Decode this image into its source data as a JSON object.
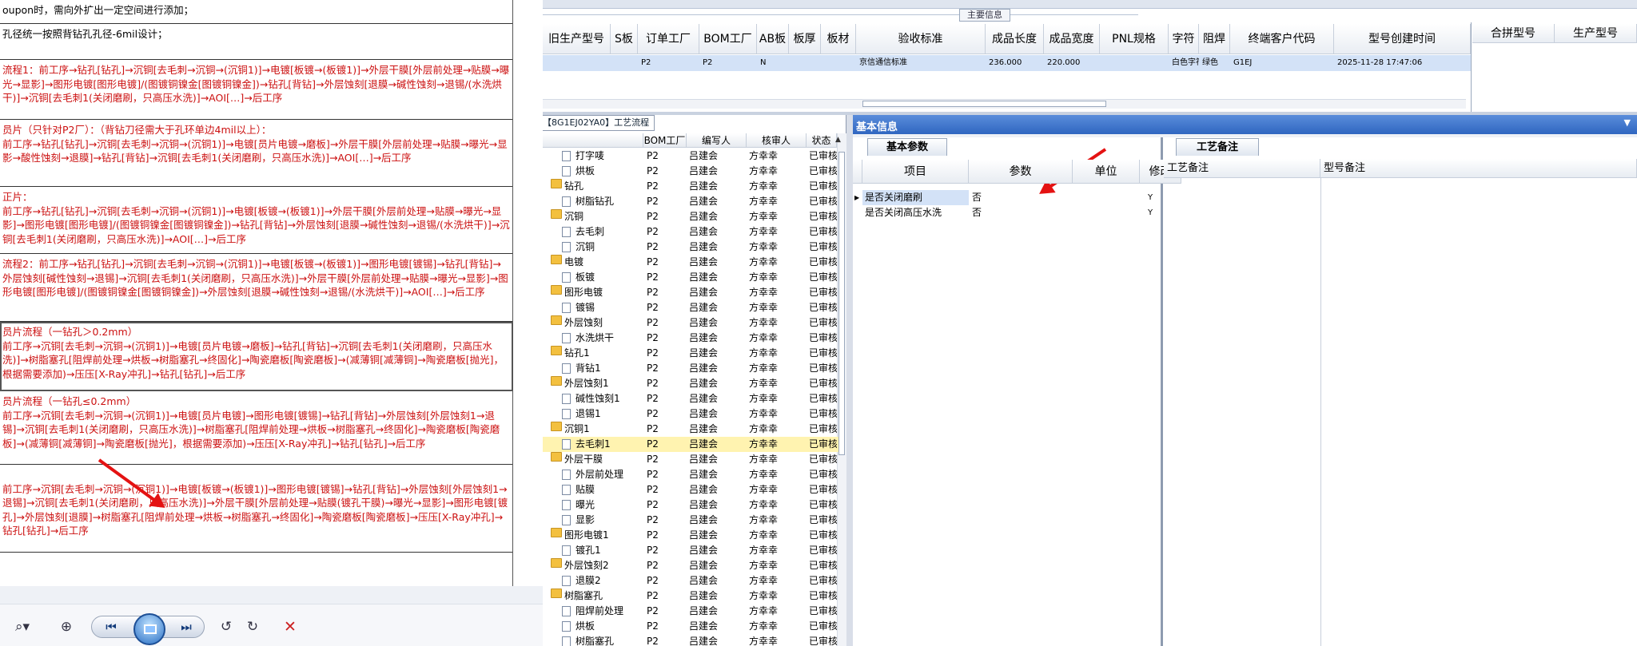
{
  "doc": {
    "rows": [
      {
        "text": "oupon时，需向外扩出一定空间进行添加；",
        "red": false
      },
      {
        "text": "孔径统一按照背钻孔孔径-6mil设计；",
        "red": false
      },
      {
        "text": "流程1：前工序→钻孔[钻孔]→沉铜[去毛刺→沉铜→(沉铜1)]→电镀[板镀→(板镀1)]→外层干膜[外层前处理→贴膜→曝光→显影]→图形电镀[图形电镀]/(图镀铜镍金[图镀铜镍金])→钻孔[背钻]→外层蚀刻[退膜→碱性蚀刻→退锡/(水洗烘干)]→沉铜[去毛刺1(关闭磨刷，只高压水洗)]→AOI[…]→后工序",
        "red": true
      },
      {
        "text": "员片（只针对P2厂）：（背钻刀径需大于孔环单边4mil以上）：\n前工序→钻孔[钻孔]→沉铜[去毛刺→沉铜→(沉铜1)]→电镀[员片电镀→磨板]→外层干膜[外层前处理→贴膜→曝光→显影→酸性蚀刻→退膜]→钻孔[背钻]→沉铜[去毛刺1(关闭磨刷，只高压水洗)]→AOI[…]→后工序",
        "red": true
      },
      {
        "text": "正片：\n前工序→钻孔[钻孔]→沉铜[去毛刺→沉铜→(沉铜1)]→电镀[板镀→(板镀1)]→外层干膜[外层前处理→贴膜→曝光→显影]→图形电镀[图形电镀]/(图镀铜镍金[图镀铜镍金])→钻孔[背钻]→外层蚀刻[退膜→碱性蚀刻→退锡/(水洗烘干)]→沉铜[去毛刺1(关闭磨刷，只高压水洗)]→AOI[…]→后工序",
        "red": true
      },
      {
        "text": "流程2：前工序→钻孔[钻孔]→沉铜[去毛刺→沉铜→(沉铜1)]→电镀[板镀→(板镀1)]→图形电镀[镀锡]→钻孔[背钻]→外层蚀刻[碱性蚀刻→退锡]→沉铜[去毛刺1(关闭磨刷，只高压水洗)]→外层干膜[外层前处理→贴膜→曝光→显影]→图形电镀[图形电镀]/(图镀铜镍金[图镀铜镍金])→外层蚀刻[退膜→碱性蚀刻→退锡/(水洗烘干)]→AOI[…]→后工序",
        "red": true
      },
      {
        "text": "员片流程（一钻孔＞0.2mm）\n前工序→沉铜[去毛刺→沉铜→(沉铜1)]→电镀[员片电镀→磨板]→钻孔[背钻]→沉铜[去毛刺1(关闭磨刷，只高压水洗)]→树脂塞孔[阻焊前处理→烘板→树脂塞孔→终固化]→陶瓷磨板[陶瓷磨板]→(减薄铜[减薄铜]→陶瓷磨板[抛光]，根据需要添加)→压压[X-Ray冲孔]→钻孔[钻孔]→后工序",
        "red": true
      },
      {
        "text": "员片流程（一钻孔≤0.2mm）\n前工序→沉铜[去毛刺→沉铜→(沉铜1)]→电镀[员片电镀]→图形电镀[镀锡]→钻孔[背钻]→外层蚀刻[外层蚀刻1→退锡]→沉铜[去毛刺1(关闭磨刷，只高压水洗)]→树脂塞孔[阻焊前处理→烘板→树脂塞孔→终固化]→陶瓷磨板[陶瓷磨板]→(减薄铜[减薄铜]→陶瓷磨板[抛光]，根据需要添加)→压压[X-Ray冲孔]→钻孔[钻孔]→后工序",
        "red": true
      },
      {
        "text": "\n前工序→沉铜[去毛刺→沉铜→(沉铜1)]→电镀[板镀→(板镀1)]→图形电镀[镀锡]→钻孔[背钻]→外层蚀刻[外层蚀刻1→退锡]→沉铜[去毛刺1(关闭磨刷，只高压水洗)]→外层干膜[外层前处理→贴膜(镀孔干膜)→曝光→显影]→图形电镀[镀孔]→外层蚀刻[退膜]→树脂塞孔[阻焊前处理→烘板→树脂塞孔→终固化]→陶瓷磨板[陶瓷磨板]→压压[X-Ray冲孔]→钻孔[钻孔]→后工序",
        "red": true
      }
    ]
  },
  "main": {
    "group_title": "主要信息",
    "headers": [
      "旧生产型号",
      "S板",
      "订单工厂",
      "BOM工厂",
      "AB板",
      "板厚",
      "板材",
      "验收标准",
      "成品长度",
      "成品宽度",
      "PNL规格",
      "字符",
      "阻焊",
      "终端客户代码",
      "型号创建时间"
    ],
    "row": [
      "",
      "",
      "P2",
      "P2",
      "N",
      "",
      "",
      "京信通信标准",
      "236.000",
      "220.000",
      "",
      "白色字符",
      "绿色",
      "G1EJ",
      "2025-11-28 17:47:06"
    ],
    "right_headers": [
      "合拼型号",
      "生产型号"
    ]
  },
  "tree": {
    "caption": "【8G1EJ02YA0】工艺流程",
    "headers": [
      "",
      "BOM工厂",
      "编写人",
      "核审人",
      "状态"
    ],
    "rows": [
      {
        "name": "打字唛",
        "level": 2,
        "type": "file",
        "bom": "P2",
        "writer": "吕建会",
        "reviewer": "方幸幸",
        "status": "已审核"
      },
      {
        "name": "烘板",
        "level": 2,
        "type": "file",
        "bom": "P2",
        "writer": "吕建会",
        "reviewer": "方幸幸",
        "status": "已审核"
      },
      {
        "name": "钻孔",
        "level": 1,
        "type": "folder",
        "bom": "P2",
        "writer": "吕建会",
        "reviewer": "方幸幸",
        "status": "已审核"
      },
      {
        "name": "树脂钻孔",
        "level": 2,
        "type": "file",
        "bom": "P2",
        "writer": "吕建会",
        "reviewer": "方幸幸",
        "status": "已审核"
      },
      {
        "name": "沉铜",
        "level": 1,
        "type": "folder",
        "bom": "P2",
        "writer": "吕建会",
        "reviewer": "方幸幸",
        "status": "已审核"
      },
      {
        "name": "去毛刺",
        "level": 2,
        "type": "file",
        "bom": "P2",
        "writer": "吕建会",
        "reviewer": "方幸幸",
        "status": "已审核"
      },
      {
        "name": "沉铜",
        "level": 2,
        "type": "file",
        "bom": "P2",
        "writer": "吕建会",
        "reviewer": "方幸幸",
        "status": "已审核"
      },
      {
        "name": "电镀",
        "level": 1,
        "type": "folder",
        "bom": "P2",
        "writer": "吕建会",
        "reviewer": "方幸幸",
        "status": "已审核"
      },
      {
        "name": "板镀",
        "level": 2,
        "type": "file",
        "bom": "P2",
        "writer": "吕建会",
        "reviewer": "方幸幸",
        "status": "已审核"
      },
      {
        "name": "图形电镀",
        "level": 1,
        "type": "folder",
        "bom": "P2",
        "writer": "吕建会",
        "reviewer": "方幸幸",
        "status": "已审核"
      },
      {
        "name": "镀锡",
        "level": 2,
        "type": "file",
        "bom": "P2",
        "writer": "吕建会",
        "reviewer": "方幸幸",
        "status": "已审核"
      },
      {
        "name": "外层蚀刻",
        "level": 1,
        "type": "folder",
        "bom": "P2",
        "writer": "吕建会",
        "reviewer": "方幸幸",
        "status": "已审核"
      },
      {
        "name": "水洗烘干",
        "level": 2,
        "type": "file",
        "bom": "P2",
        "writer": "吕建会",
        "reviewer": "方幸幸",
        "status": "已审核"
      },
      {
        "name": "钻孔1",
        "level": 1,
        "type": "folder",
        "bom": "P2",
        "writer": "吕建会",
        "reviewer": "方幸幸",
        "status": "已审核"
      },
      {
        "name": "背钻1",
        "level": 2,
        "type": "file",
        "bom": "P2",
        "writer": "吕建会",
        "reviewer": "方幸幸",
        "status": "已审核"
      },
      {
        "name": "外层蚀刻1",
        "level": 1,
        "type": "folder",
        "bom": "P2",
        "writer": "吕建会",
        "reviewer": "方幸幸",
        "status": "已审核"
      },
      {
        "name": "碱性蚀刻1",
        "level": 2,
        "type": "file",
        "bom": "P2",
        "writer": "吕建会",
        "reviewer": "方幸幸",
        "status": "已审核"
      },
      {
        "name": "退锡1",
        "level": 2,
        "type": "file",
        "bom": "P2",
        "writer": "吕建会",
        "reviewer": "方幸幸",
        "status": "已审核"
      },
      {
        "name": "沉铜1",
        "level": 1,
        "type": "folder",
        "bom": "P2",
        "writer": "吕建会",
        "reviewer": "方幸幸",
        "status": "已审核"
      },
      {
        "name": "去毛刺1",
        "level": 2,
        "type": "file",
        "bom": "P2",
        "writer": "吕建会",
        "reviewer": "方幸幸",
        "status": "已审核",
        "selected": true
      },
      {
        "name": "外层干膜",
        "level": 1,
        "type": "folder",
        "bom": "P2",
        "writer": "吕建会",
        "reviewer": "方幸幸",
        "status": "已审核"
      },
      {
        "name": "外层前处理",
        "level": 2,
        "type": "file",
        "bom": "P2",
        "writer": "吕建会",
        "reviewer": "方幸幸",
        "status": "已审核"
      },
      {
        "name": "贴膜",
        "level": 2,
        "type": "file",
        "bom": "P2",
        "writer": "吕建会",
        "reviewer": "方幸幸",
        "status": "已审核"
      },
      {
        "name": "曝光",
        "level": 2,
        "type": "file",
        "bom": "P2",
        "writer": "吕建会",
        "reviewer": "方幸幸",
        "status": "已审核"
      },
      {
        "name": "显影",
        "level": 2,
        "type": "file",
        "bom": "P2",
        "writer": "吕建会",
        "reviewer": "方幸幸",
        "status": "已审核"
      },
      {
        "name": "图形电镀1",
        "level": 1,
        "type": "folder",
        "bom": "P2",
        "writer": "吕建会",
        "reviewer": "方幸幸",
        "status": "已审核"
      },
      {
        "name": "镀孔1",
        "level": 2,
        "type": "file",
        "bom": "P2",
        "writer": "吕建会",
        "reviewer": "方幸幸",
        "status": "已审核"
      },
      {
        "name": "外层蚀刻2",
        "level": 1,
        "type": "folder",
        "bom": "P2",
        "writer": "吕建会",
        "reviewer": "方幸幸",
        "status": "已审核"
      },
      {
        "name": "退膜2",
        "level": 2,
        "type": "file",
        "bom": "P2",
        "writer": "吕建会",
        "reviewer": "方幸幸",
        "status": "已审核"
      },
      {
        "name": "树脂塞孔",
        "level": 1,
        "type": "folder",
        "bom": "P2",
        "writer": "吕建会",
        "reviewer": "方幸幸",
        "status": "已审核"
      },
      {
        "name": "阻焊前处理",
        "level": 2,
        "type": "file",
        "bom": "P2",
        "writer": "吕建会",
        "reviewer": "方幸幸",
        "status": "已审核"
      },
      {
        "name": "烘板",
        "level": 2,
        "type": "file",
        "bom": "P2",
        "writer": "吕建会",
        "reviewer": "方幸幸",
        "status": "已审核"
      },
      {
        "name": "树脂塞孔",
        "level": 2,
        "type": "file",
        "bom": "P2",
        "writer": "吕建会",
        "reviewer": "方幸幸",
        "status": "已审核"
      }
    ]
  },
  "basic": {
    "title": "基本信息",
    "tab_params": "基本参数",
    "tab_notes": "工艺备注",
    "param_headers": [
      "项目",
      "参数",
      "单位",
      "修改"
    ],
    "params": [
      {
        "item": "是否关闭磨刷",
        "value": "否",
        "unit": "",
        "edit": "Y"
      },
      {
        "item": "是否关闭高压水洗",
        "value": "否",
        "unit": "",
        "edit": "Y"
      }
    ],
    "note_headers": [
      "工艺备注",
      "型号备注"
    ]
  },
  "colors": {
    "doc_red": "#cc1111",
    "header_blue": "#2f66c0",
    "selection": "#d3e2f7",
    "tree_highlight": "#fff3b0",
    "arrow": "#e41212"
  }
}
